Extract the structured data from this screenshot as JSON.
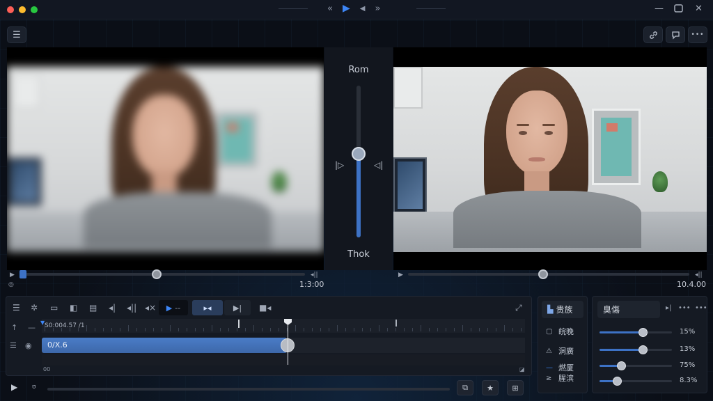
{
  "titlebar": {
    "rewind_icon": "double-chevron-left",
    "play_icon": "play",
    "step_icon": "small-triangle-left",
    "forward_icon": "double-chevron-right"
  },
  "toolbar": {
    "menu_icon": "☰",
    "link_icon": "🔗",
    "comment_icon": "▭",
    "more_icon": "•••"
  },
  "compare": {
    "top_label": "Rom",
    "bottom_label": "Thok",
    "split_position": 0.45
  },
  "left_player": {
    "timecode": "1:3:00",
    "progress": 0.48
  },
  "right_player": {
    "timecode": "10.4.00",
    "progress": 0.48
  },
  "timeline": {
    "ruler_label": "S0:004.57 /1",
    "clip_label": "0/Х.6",
    "clip_start_label": "00"
  },
  "side_panel": {
    "header": "贵族",
    "items": [
      {
        "icon": "square",
        "label": "皖晚"
      },
      {
        "icon": "warning",
        "label": "洞廣"
      },
      {
        "icon": "dash",
        "label": "燃厦"
      },
      {
        "icon": "arrow",
        "label": "腥滨"
      }
    ]
  },
  "props_panel": {
    "header": "臭傷",
    "sliders": [
      {
        "value_text": "15%",
        "level": 0.6
      },
      {
        "value_text": "13%",
        "level": 0.6
      },
      {
        "value_text": "75%",
        "level": 0.3
      },
      {
        "value_text": "8.3%",
        "level": 0.24
      }
    ]
  },
  "colors": {
    "accent": "#3d86f6",
    "clip": "#4a7cc7",
    "background": "#0b0f17"
  }
}
